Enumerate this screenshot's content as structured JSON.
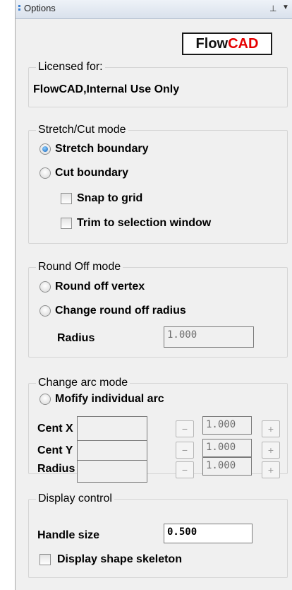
{
  "panel": {
    "title": "Options",
    "pin_glyph": "⊥",
    "menu_glyph": "▼"
  },
  "logo": {
    "part1": "Flow",
    "part2": "CAD",
    "colors": {
      "part1": "#111111",
      "part2": "#e60000"
    }
  },
  "license": {
    "legend": "Licensed for:",
    "value": "FlowCAD,Internal Use Only"
  },
  "stretch_cut": {
    "legend": "Stretch/Cut mode",
    "stretch_label": "Stretch boundary",
    "cut_label": "Cut boundary",
    "snap_label": "Snap to grid",
    "trim_label": "Trim to selection window",
    "selected": "stretch"
  },
  "round_off": {
    "legend": "Round Off mode",
    "vertex_label": "Round off vertex",
    "radius_mode_label": "Change round off radius",
    "radius_label": "Radius",
    "radius_value": "1.000"
  },
  "arc": {
    "legend": "Change arc mode",
    "modify_label": "Mofify individual arc",
    "rows": [
      {
        "label": "Cent X",
        "minus": "−",
        "value": "1.000",
        "plus": "+"
      },
      {
        "label": "Cent Y",
        "minus": "−",
        "value": "1.000",
        "plus": "+"
      },
      {
        "label": "Radius",
        "minus": "−",
        "value": "1.000",
        "plus": "+"
      }
    ]
  },
  "display": {
    "legend": "Display control",
    "handle_label": "Handle size",
    "handle_value": "0.500",
    "skeleton_label": "Display shape skeleton"
  }
}
